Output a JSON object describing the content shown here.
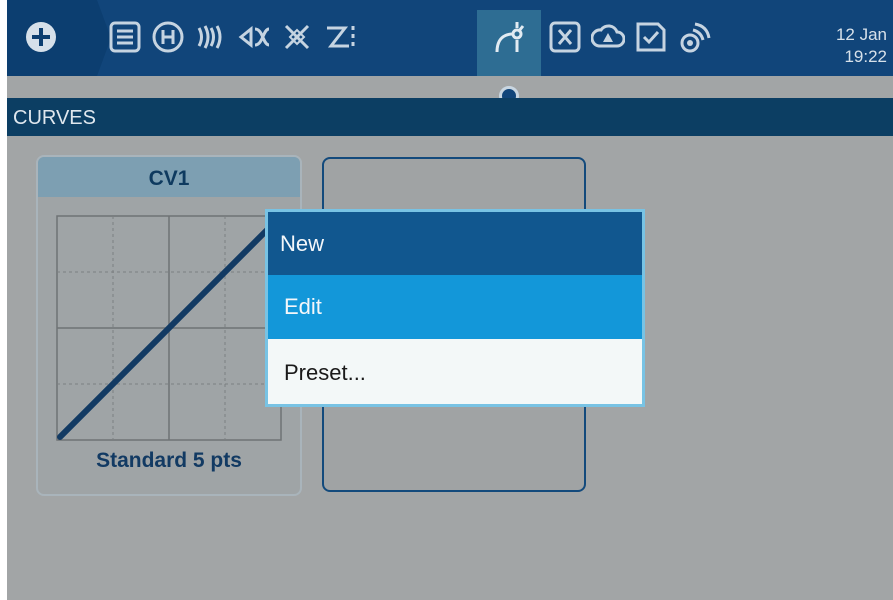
{
  "topbar": {
    "icons": [
      "home-plus-icon",
      "list-icon",
      "helicopter-mode-icon",
      "mixer-waves-icon",
      "input-mix-icon",
      "cross-logic-icon",
      "trainer-icon",
      "curves-icon",
      "variables-icon",
      "telemetry-cloud-icon",
      "checklist-icon",
      "sound-eye-icon"
    ],
    "active_tab": "curves-icon",
    "date": "12 Jan",
    "time": "19:22"
  },
  "page": {
    "title": "CURVES"
  },
  "curves": [
    {
      "name": "CV1",
      "subtitle": "Standard 5 pts",
      "points": [
        -100,
        -50,
        0,
        50,
        100
      ]
    }
  ],
  "context_menu": {
    "header": "New",
    "items": [
      "Edit",
      "Preset..."
    ],
    "highlighted": "Edit"
  },
  "colors": {
    "topbar": "#11457a",
    "titlebar": "#0c3e63",
    "menu_header": "#11578f",
    "menu_selected": "#1397d9"
  }
}
